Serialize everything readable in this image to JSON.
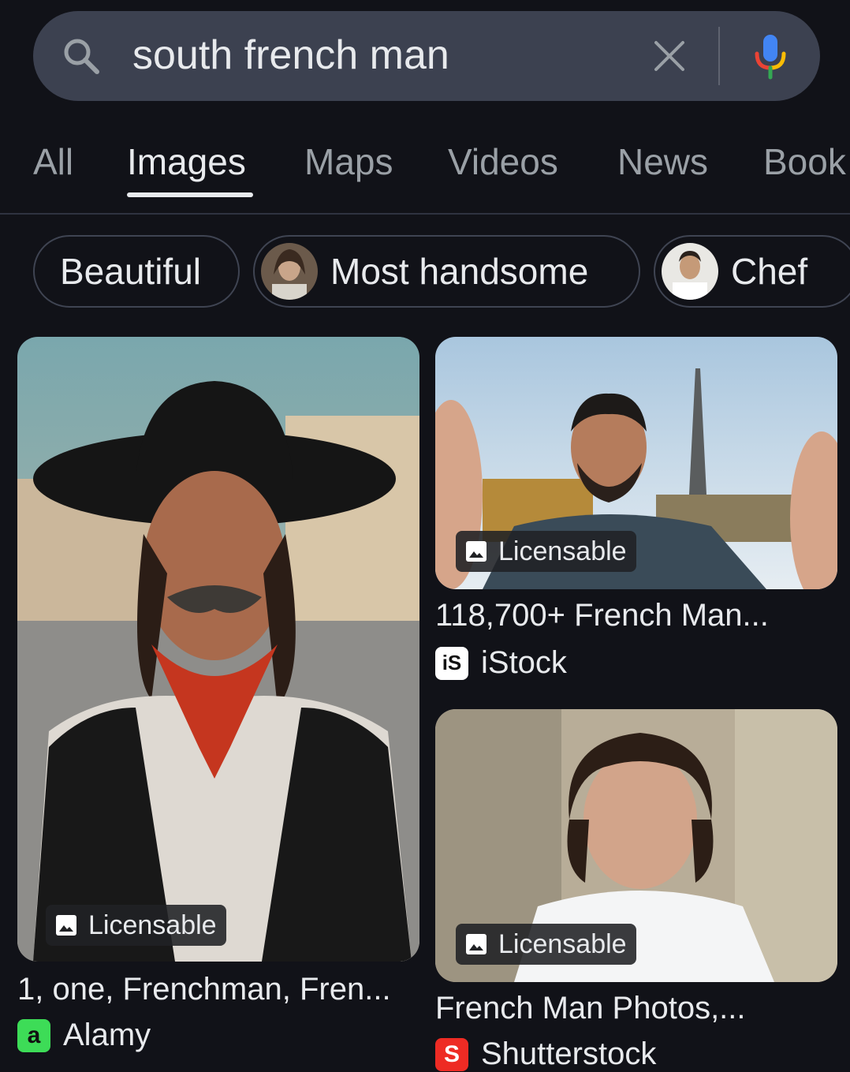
{
  "search": {
    "query": "south french man"
  },
  "tabs": [
    {
      "label": "All"
    },
    {
      "label": "Images"
    },
    {
      "label": "Maps"
    },
    {
      "label": "Videos"
    },
    {
      "label": "News"
    },
    {
      "label": "Book"
    }
  ],
  "chips": [
    {
      "label": "Beautiful"
    },
    {
      "label": "Most handsome"
    },
    {
      "label": "Chef"
    }
  ],
  "results": [
    {
      "badge": "Licensable",
      "title": "1, one, Frenchman, Fren...",
      "source": "Alamy",
      "favicon_letter": "a"
    },
    {
      "badge": "Licensable",
      "title": "118,700+ French Man...",
      "source": "iStock",
      "favicon_letter": "iS"
    },
    {
      "badge": "Licensable",
      "title": "French Man Photos,...",
      "source": "Shutterstock",
      "favicon_letter": "S"
    }
  ],
  "colors": {
    "background": "#111218",
    "searchbar": "#3c4150",
    "active_text": "#e8eaed",
    "inactive_text": "#9aa0a6",
    "alamy_green": "#3ddc57",
    "shutterstock_red": "#ee2b24"
  }
}
